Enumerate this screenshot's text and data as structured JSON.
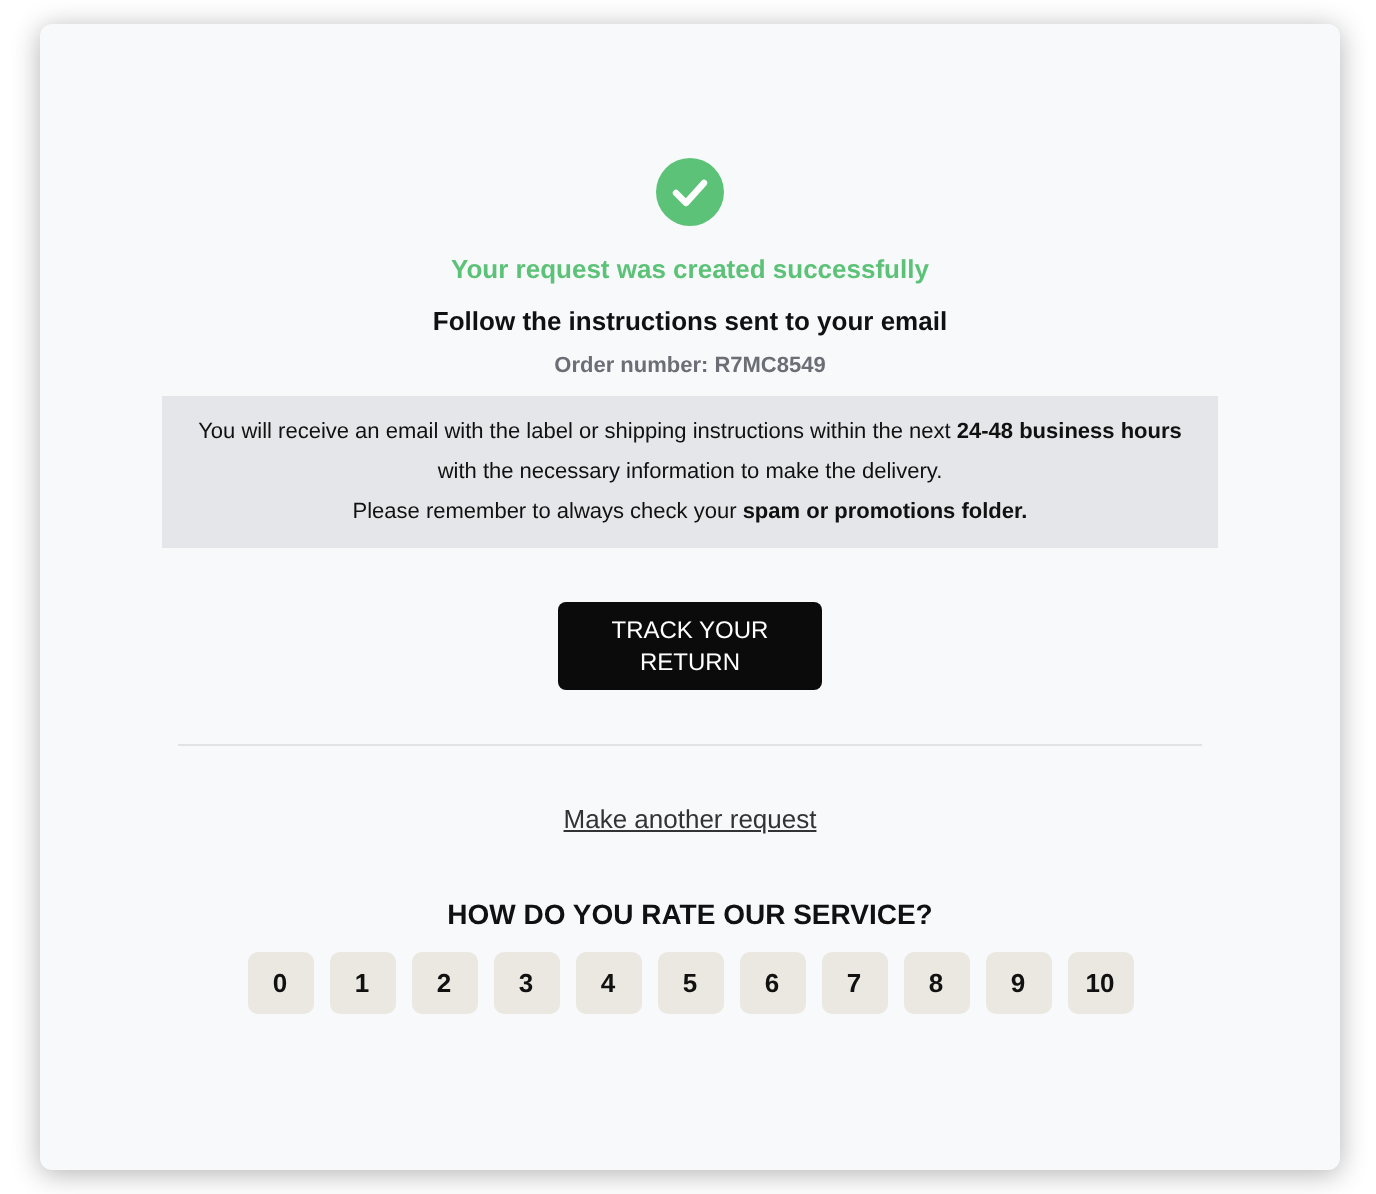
{
  "status": {
    "title": "Your request was created successfully",
    "subtitle": "Follow the instructions sent to your email",
    "order_number": "Order number: R7MC8549"
  },
  "notice": [
    "You will receive an email with the label or shipping instructions within the next **24-48 business hours** with the necessary information to make the delivery.",
    "Please remember to always check your **spam or promotions folder.**"
  ],
  "track_button": {
    "label": "TRACK YOUR RETURN"
  },
  "another_request_link": "Make another request",
  "rating": {
    "question": "HOW DO YOU RATE OUR SERVICE?",
    "options": [
      "0",
      "1",
      "2",
      "3",
      "4",
      "5",
      "6",
      "7",
      "8",
      "9",
      "10"
    ]
  }
}
